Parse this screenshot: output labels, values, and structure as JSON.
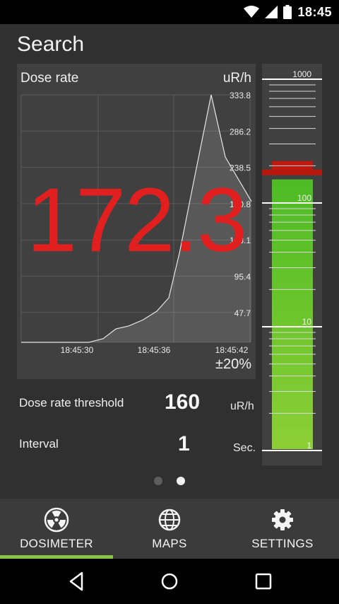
{
  "status_bar": {
    "time": "18:45",
    "icons": [
      "wifi-icon",
      "signal-icon",
      "battery-icon"
    ]
  },
  "toolbar": {
    "title": "Search"
  },
  "chart": {
    "label": "Dose rate",
    "unit": "uR/h",
    "accuracy": "±20%",
    "reading": "172.3",
    "reading_color": "#e21f1f",
    "y_ticks": [
      "333.8",
      "286.2",
      "238.5",
      "190.8",
      "143.1",
      "95.4",
      "47.7"
    ],
    "x_ticks": [
      "18:45:30",
      "18:45:36",
      "18:45:42"
    ]
  },
  "chart_data": {
    "type": "area",
    "title": "Dose rate",
    "ylabel": "uR/h",
    "ylim": [
      0,
      333.8
    ],
    "x_labels": [
      "18:45:30",
      "18:45:36",
      "18:45:42"
    ],
    "x": [
      0,
      1,
      2,
      3,
      4,
      5,
      6,
      7,
      8,
      9,
      10,
      11,
      12,
      13,
      14,
      15
    ],
    "values": [
      0,
      0,
      0,
      0,
      0,
      5,
      18,
      22,
      30,
      42,
      60,
      120,
      225,
      333.8,
      250,
      190
    ],
    "grid": true
  },
  "scale": {
    "labels": [
      "1000",
      "100",
      "10",
      "1"
    ],
    "fill_color": "#6fc029",
    "marker_color": "#c0180f",
    "level": 172.3
  },
  "params": {
    "threshold": {
      "label": "Dose rate threshold",
      "value": "160",
      "unit": "uR/h"
    },
    "interval": {
      "label": "Interval",
      "value": "1",
      "unit": "Sec."
    }
  },
  "pager": {
    "pages": 2,
    "active": 2
  },
  "tabs": [
    {
      "label": "DOSIMETER",
      "icon": "radiation-icon",
      "active": true
    },
    {
      "label": "MAPS",
      "icon": "globe-icon",
      "active": false
    },
    {
      "label": "SETTINGS",
      "icon": "gear-icon",
      "active": false
    }
  ],
  "colors": {
    "accent": "#8bc34a",
    "background": "#303030",
    "panel": "#404040"
  }
}
